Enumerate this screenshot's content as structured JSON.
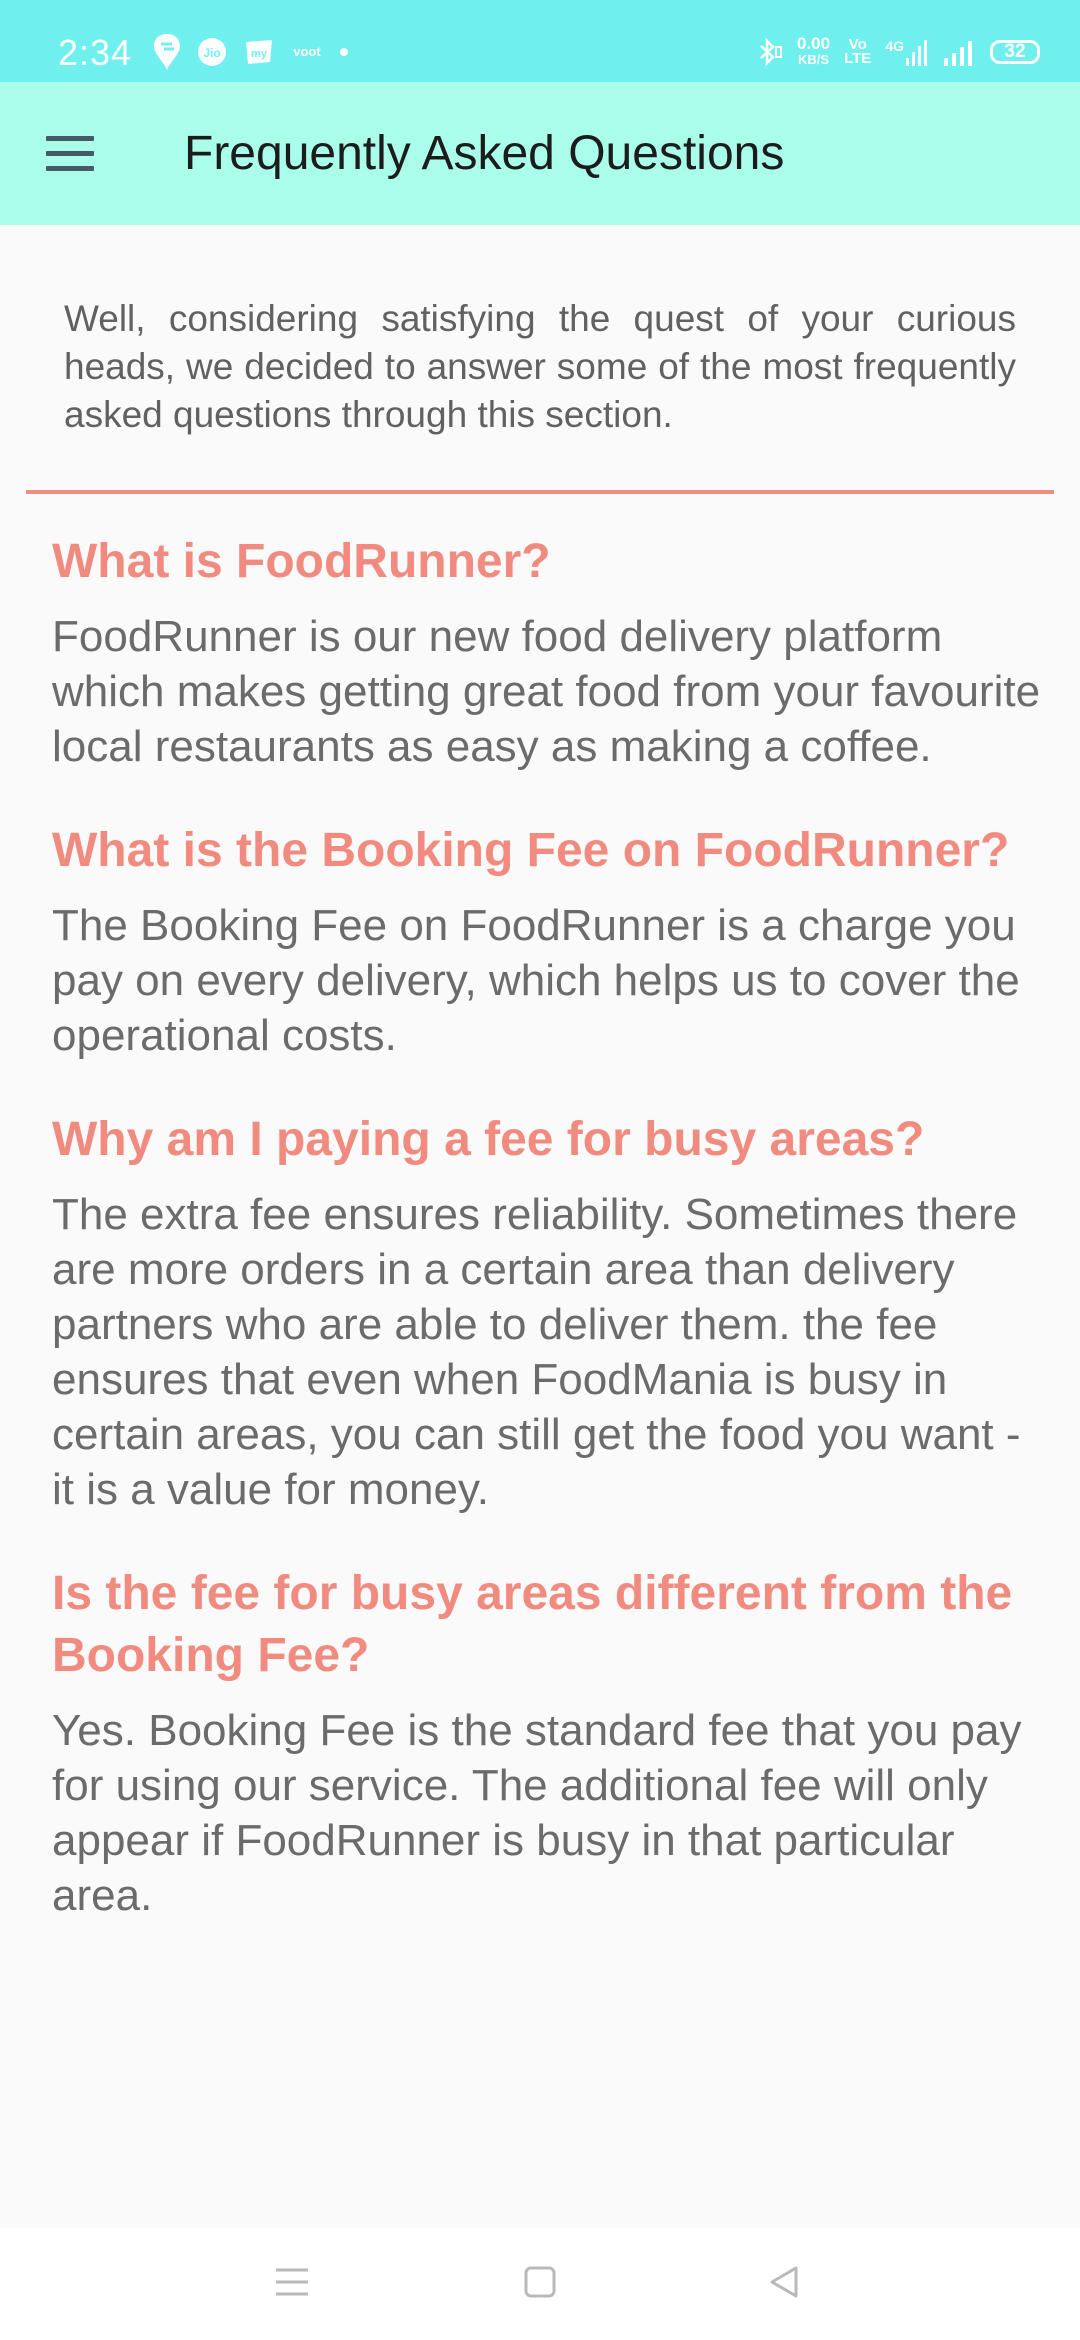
{
  "status_bar": {
    "time": "2:34",
    "net_speed_value": "0.00",
    "net_speed_unit": "KB/S",
    "volte_top": "Vo",
    "volte_bottom": "LTE",
    "network_type": "4G",
    "battery": "32",
    "icons": [
      "swiggy-icon",
      "jio-icon",
      "myjio-icon",
      "voot-icon",
      "dot-icon",
      "bluetooth-icon",
      "signal-icon"
    ]
  },
  "app_bar": {
    "title": "Frequently Asked Questions",
    "menu_icon": "hamburger-menu-icon"
  },
  "intro": "Well, considering satisfying the quest of your curious heads, we decided to answer some of the most frequently asked questions through this section.",
  "colors": {
    "status_bar": "#6ff0ef",
    "app_bar": "#a9ffea",
    "accent": "#f28b7f",
    "body_text": "#6b6b6b"
  },
  "faqs": [
    {
      "question": "What is FoodRunner?",
      "answer": "FoodRunner is our new food delivery platform which makes getting great food from your favourite local restaurants as easy as making a coffee."
    },
    {
      "question": "What is the Booking Fee on FoodRunner?",
      "answer": "The Booking Fee on FoodRunner is a charge you pay on every delivery, which helps us to cover the operational costs."
    },
    {
      "question": "Why am I paying a fee for busy areas?",
      "answer": "The extra fee ensures reliability. Sometimes there are more orders in a certain area than delivery partners who are able to deliver them. the fee ensures that even when FoodMania is busy in certain areas, you can still get the food you want - it is a value for money."
    },
    {
      "question": "Is the fee for busy areas different from the Booking Fee?",
      "answer": "Yes. Booking Fee is the standard fee that you pay for using our service. The additional fee will only appear if FoodRunner is busy in that particular area."
    }
  ],
  "nav_bar": {
    "icons": [
      "recents-menu-icon",
      "home-square-icon",
      "back-triangle-icon"
    ]
  }
}
